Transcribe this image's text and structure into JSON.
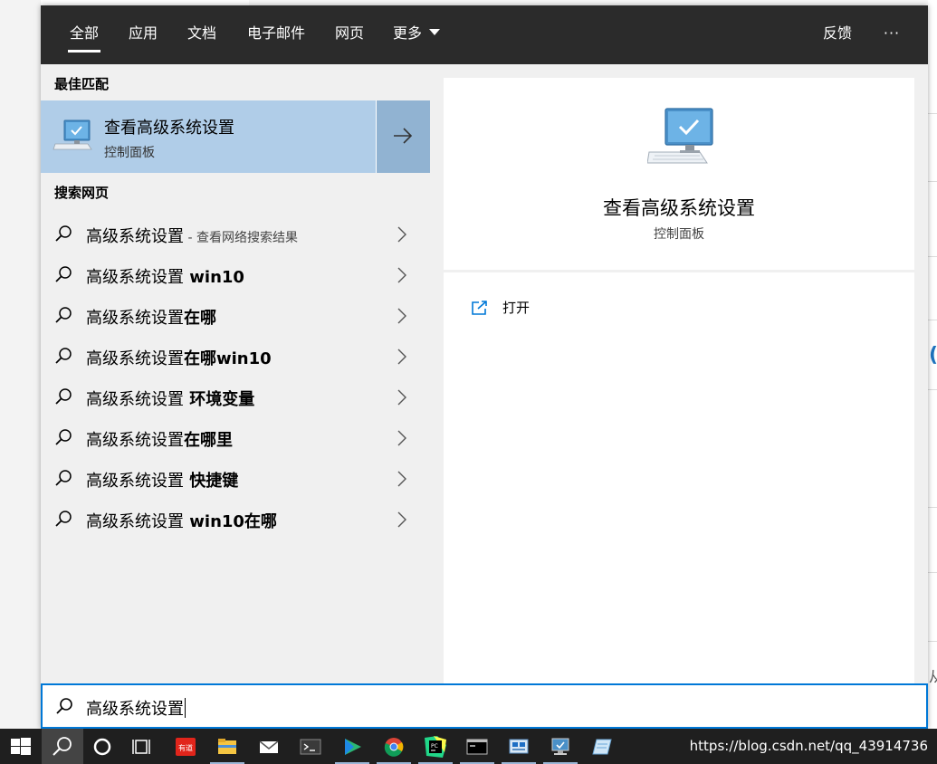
{
  "tabs": [
    {
      "label": "全部",
      "active": true
    },
    {
      "label": "应用"
    },
    {
      "label": "文档"
    },
    {
      "label": "电子邮件"
    },
    {
      "label": "网页"
    },
    {
      "label": "更多"
    }
  ],
  "header_actions": {
    "feedback": "反馈",
    "more_options": "···"
  },
  "best_match": {
    "section_title": "最佳匹配",
    "title": "查看高级系统设置",
    "subtitle": "控制面板",
    "icon": "computer-monitor-icon"
  },
  "web_search": {
    "section_title": "搜索网页",
    "items": [
      {
        "base": "高级系统设置",
        "suffix": "",
        "hint": " - 查看网络搜索结果"
      },
      {
        "base": "高级系统设置",
        "suffix": " win10",
        "hint": ""
      },
      {
        "base": "高级系统设置",
        "suffix": "在哪",
        "hint": ""
      },
      {
        "base": "高级系统设置",
        "suffix": "在哪win10",
        "hint": ""
      },
      {
        "base": "高级系统设置",
        "suffix": " 环境变量",
        "hint": ""
      },
      {
        "base": "高级系统设置",
        "suffix": "在哪里",
        "hint": ""
      },
      {
        "base": "高级系统设置",
        "suffix": " 快捷键",
        "hint": ""
      },
      {
        "base": "高级系统设置",
        "suffix": " win10在哪",
        "hint": ""
      }
    ]
  },
  "preview": {
    "title": "查看高级系统设置",
    "subtitle": "控制面板",
    "actions": [
      {
        "label": "打开",
        "icon": "open-external-icon"
      }
    ]
  },
  "search": {
    "value": "高级系统设置"
  },
  "taskbar": {
    "items": [
      "windows-start-icon",
      "search-icon",
      "cortana-circle-icon",
      "task-view-icon",
      "youdao-icon",
      "file-explorer-icon",
      "mail-icon",
      "terminal-icon",
      "media-player-icon",
      "chrome-icon",
      "pycharm-icon",
      "cmd-icon",
      "network-adapter-icon",
      "monitor-settings-icon",
      "notepad-icon"
    ],
    "youdao_label": "有道",
    "pycharm_label": "PC"
  },
  "watermark": "https://blog.csdn.net/qq_43914736",
  "colors": {
    "accent": "#0078d7",
    "selected": "#b0cde8",
    "topbar": "#2b2b2b",
    "taskbar": "#1f1f1f"
  }
}
